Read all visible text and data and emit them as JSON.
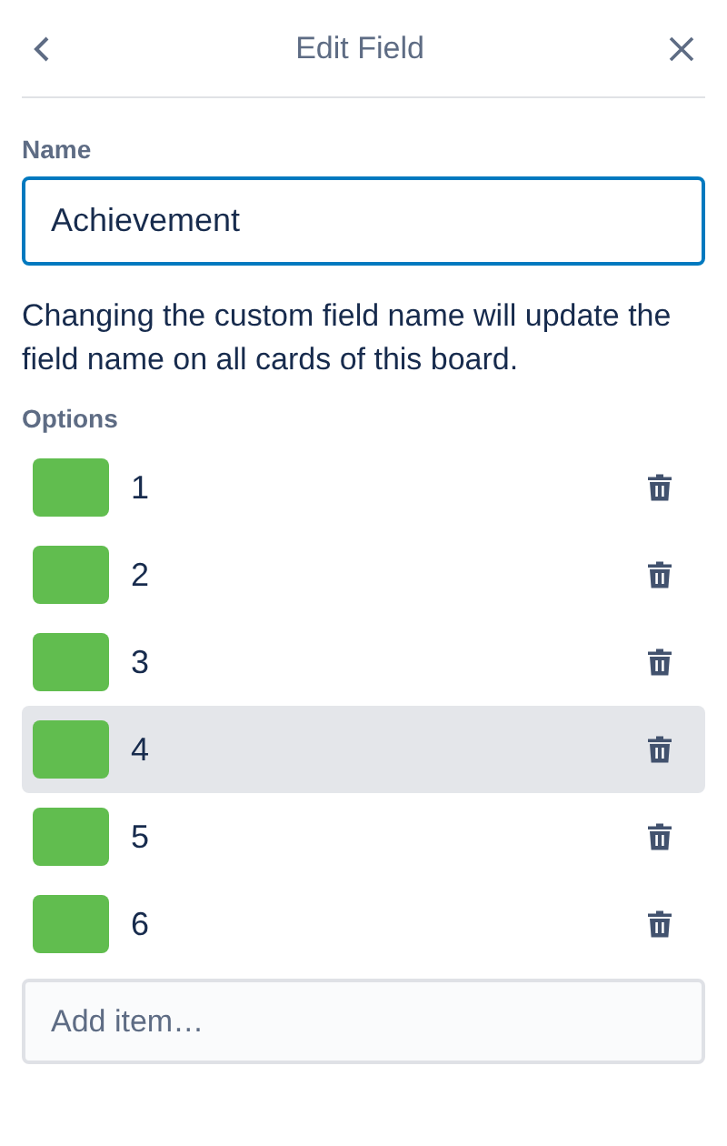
{
  "header": {
    "title": "Edit Field"
  },
  "name_field": {
    "label": "Name",
    "value": "Achievement"
  },
  "description": "Changing the custom field name will update the field name on all cards of this board.",
  "options": {
    "label": "Options",
    "items": [
      {
        "text": "1",
        "color": "#61bd4f",
        "hovered": false
      },
      {
        "text": "2",
        "color": "#61bd4f",
        "hovered": false
      },
      {
        "text": "3",
        "color": "#61bd4f",
        "hovered": false
      },
      {
        "text": "4",
        "color": "#61bd4f",
        "hovered": true
      },
      {
        "text": "5",
        "color": "#61bd4f",
        "hovered": false
      },
      {
        "text": "6",
        "color": "#61bd4f",
        "hovered": false
      }
    ]
  },
  "add_item": {
    "placeholder": "Add item…"
  }
}
